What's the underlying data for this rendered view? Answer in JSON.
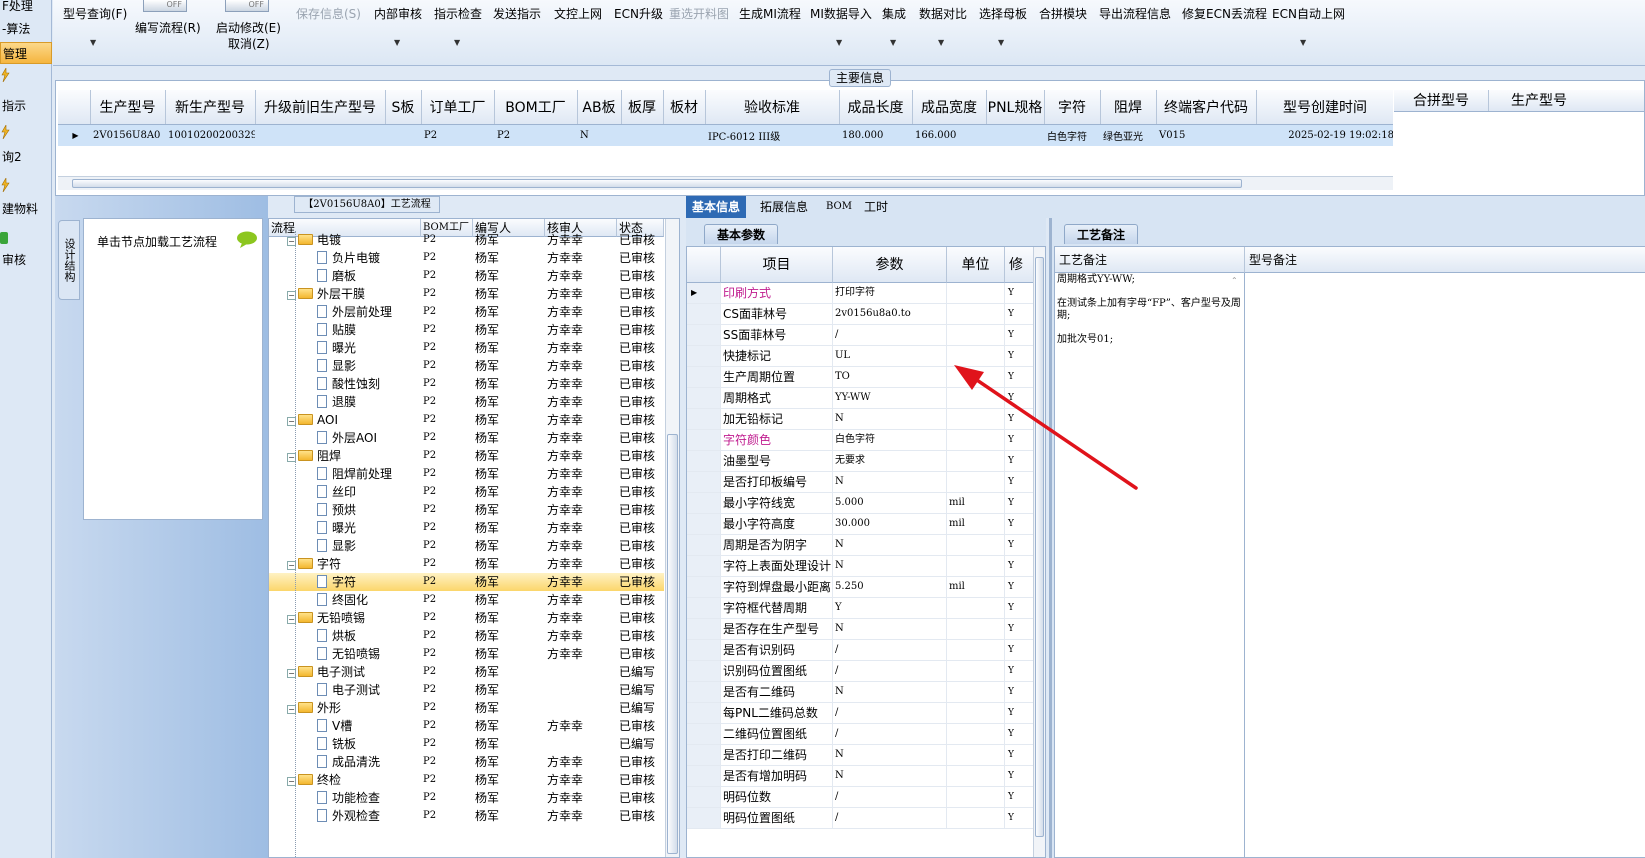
{
  "sidebar": {
    "items": [
      "F处理",
      "-算法",
      "管理",
      "指示",
      "询2",
      "建物料",
      "审核"
    ]
  },
  "ribbon": {
    "buttons": [
      "型号查询(F)",
      "编写流程(R)",
      "启动修改(E)",
      "取消(Z)",
      "保存信息(S)",
      "内部审核",
      "指示检查",
      "发送指示",
      "文控上网",
      "ECN升级",
      "重选开料图",
      "生成MI流程",
      "MI数据导入",
      "集成",
      "数据对比",
      "选择母板",
      "合拼模块",
      "导出流程信息",
      "修复ECN丢流程",
      "ECN自动上网"
    ],
    "toggle_label": "OFF"
  },
  "main_info": {
    "caption": "主要信息",
    "columns": [
      "生产型号",
      "新生产型号",
      "升级前旧生产型号",
      "S板",
      "订单工厂",
      "BOM工厂",
      "AB板",
      "板厚",
      "板材",
      "验收标准",
      "成品长度",
      "成品宽度",
      "PNL规格",
      "字符",
      "阻焊",
      "终端客户代码",
      "型号创建时间"
    ],
    "row": [
      "2V0156U8A0",
      "10010200200329",
      "",
      "",
      "P2",
      "P2",
      "N",
      "",
      "",
      "IPC-6012 III级",
      "180.000",
      "166.000",
      "",
      "白色字符",
      "绿色亚光",
      "V015",
      "2025-02-19 19:02:18"
    ],
    "right_columns": [
      "合拼型号",
      "生产型号"
    ]
  },
  "left_panel": {
    "vertical_tab": "设计结构",
    "hint": "单击节点加载工艺流程"
  },
  "process_tree": {
    "title": "【2V0156U8A0】工艺流程",
    "columns": [
      "流程",
      "BOM工厂",
      "编写人",
      "核审人",
      "状态"
    ],
    "rows": [
      {
        "name": "电镀",
        "level": 0,
        "bom": "P2",
        "writer": "杨军",
        "reviewer": "方幸幸",
        "status": "已审核"
      },
      {
        "name": "负片电镀",
        "level": 1,
        "bom": "P2",
        "writer": "杨军",
        "reviewer": "方幸幸",
        "status": "已审核"
      },
      {
        "name": "磨板",
        "level": 1,
        "bom": "P2",
        "writer": "杨军",
        "reviewer": "方幸幸",
        "status": "已审核"
      },
      {
        "name": "外层干膜",
        "level": 0,
        "bom": "P2",
        "writer": "杨军",
        "reviewer": "方幸幸",
        "status": "已审核"
      },
      {
        "name": "外层前处理",
        "level": 1,
        "bom": "P2",
        "writer": "杨军",
        "reviewer": "方幸幸",
        "status": "已审核"
      },
      {
        "name": "贴膜",
        "level": 1,
        "bom": "P2",
        "writer": "杨军",
        "reviewer": "方幸幸",
        "status": "已审核"
      },
      {
        "name": "曝光",
        "level": 1,
        "bom": "P2",
        "writer": "杨军",
        "reviewer": "方幸幸",
        "status": "已审核"
      },
      {
        "name": "显影",
        "level": 1,
        "bom": "P2",
        "writer": "杨军",
        "reviewer": "方幸幸",
        "status": "已审核"
      },
      {
        "name": "酸性蚀刻",
        "level": 1,
        "bom": "P2",
        "writer": "杨军",
        "reviewer": "方幸幸",
        "status": "已审核"
      },
      {
        "name": "退膜",
        "level": 1,
        "bom": "P2",
        "writer": "杨军",
        "reviewer": "方幸幸",
        "status": "已审核"
      },
      {
        "name": "AOI",
        "level": 0,
        "bom": "P2",
        "writer": "杨军",
        "reviewer": "方幸幸",
        "status": "已审核"
      },
      {
        "name": "外层AOI",
        "level": 1,
        "bom": "P2",
        "writer": "杨军",
        "reviewer": "方幸幸",
        "status": "已审核"
      },
      {
        "name": "阻焊",
        "level": 0,
        "bom": "P2",
        "writer": "杨军",
        "reviewer": "方幸幸",
        "status": "已审核"
      },
      {
        "name": "阻焊前处理",
        "level": 1,
        "bom": "P2",
        "writer": "杨军",
        "reviewer": "方幸幸",
        "status": "已审核"
      },
      {
        "name": "丝印",
        "level": 1,
        "bom": "P2",
        "writer": "杨军",
        "reviewer": "方幸幸",
        "status": "已审核"
      },
      {
        "name": "预烘",
        "level": 1,
        "bom": "P2",
        "writer": "杨军",
        "reviewer": "方幸幸",
        "status": "已审核"
      },
      {
        "name": "曝光",
        "level": 1,
        "bom": "P2",
        "writer": "杨军",
        "reviewer": "方幸幸",
        "status": "已审核"
      },
      {
        "name": "显影",
        "level": 1,
        "bom": "P2",
        "writer": "杨军",
        "reviewer": "方幸幸",
        "status": "已审核"
      },
      {
        "name": "字符",
        "level": 0,
        "bom": "P2",
        "writer": "杨军",
        "reviewer": "方幸幸",
        "status": "已审核"
      },
      {
        "name": "字符",
        "level": 1,
        "bom": "P2",
        "writer": "杨军",
        "reviewer": "方幸幸",
        "status": "已审核",
        "selected": true
      },
      {
        "name": "终固化",
        "level": 1,
        "bom": "P2",
        "writer": "杨军",
        "reviewer": "方幸幸",
        "status": "已审核"
      },
      {
        "name": "无铅喷锡",
        "level": 0,
        "bom": "P2",
        "writer": "杨军",
        "reviewer": "方幸幸",
        "status": "已审核"
      },
      {
        "name": "烘板",
        "level": 1,
        "bom": "P2",
        "writer": "杨军",
        "reviewer": "方幸幸",
        "status": "已审核"
      },
      {
        "name": "无铅喷锡",
        "level": 1,
        "bom": "P2",
        "writer": "杨军",
        "reviewer": "方幸幸",
        "status": "已审核"
      },
      {
        "name": "电子测试",
        "level": 0,
        "bom": "P2",
        "writer": "杨军",
        "reviewer": "",
        "status": "已编写"
      },
      {
        "name": "电子测试",
        "level": 1,
        "bom": "P2",
        "writer": "杨军",
        "reviewer": "",
        "status": "已编写"
      },
      {
        "name": "外形",
        "level": 0,
        "bom": "P2",
        "writer": "杨军",
        "reviewer": "",
        "status": "已编写"
      },
      {
        "name": "V槽",
        "level": 1,
        "bom": "P2",
        "writer": "杨军",
        "reviewer": "方幸幸",
        "status": "已审核"
      },
      {
        "name": "铣板",
        "level": 1,
        "bom": "P2",
        "writer": "杨军",
        "reviewer": "",
        "status": "已编写"
      },
      {
        "name": "成品清洗",
        "level": 1,
        "bom": "P2",
        "writer": "杨军",
        "reviewer": "方幸幸",
        "status": "已审核"
      },
      {
        "name": "终检",
        "level": 0,
        "bom": "P2",
        "writer": "杨军",
        "reviewer": "方幸幸",
        "status": "已审核"
      },
      {
        "name": "功能检查",
        "level": 1,
        "bom": "P2",
        "writer": "杨军",
        "reviewer": "方幸幸",
        "status": "已审核"
      },
      {
        "name": "外观检查",
        "level": 1,
        "bom": "P2",
        "writer": "杨军",
        "reviewer": "方幸幸",
        "status": "已审核"
      }
    ]
  },
  "detail_tabs": [
    "基本信息",
    "拓展信息",
    "BOM",
    "工时"
  ],
  "basic_params": {
    "section_tab": "基本参数",
    "columns": [
      "项目",
      "参数",
      "单位",
      "修"
    ],
    "rows": [
      {
        "item": "印刷方式",
        "value": "打印字符",
        "unit": "",
        "flag": "Y",
        "pink": true
      },
      {
        "item": "CS面菲林号",
        "value": "2v0156u8a0.to",
        "unit": "",
        "flag": "Y"
      },
      {
        "item": "SS面菲林号",
        "value": "/",
        "unit": "",
        "flag": "Y"
      },
      {
        "item": "快捷标记",
        "value": "UL",
        "unit": "",
        "flag": "Y"
      },
      {
        "item": "生产周期位置",
        "value": "TO",
        "unit": "",
        "flag": "Y"
      },
      {
        "item": "周期格式",
        "value": "YY-WW",
        "unit": "",
        "flag": "Y"
      },
      {
        "item": "加无铅标记",
        "value": "N",
        "unit": "",
        "flag": "Y"
      },
      {
        "item": "字符颜色",
        "value": "白色字符",
        "unit": "",
        "flag": "Y",
        "pink": true
      },
      {
        "item": "油墨型号",
        "value": "无要求",
        "unit": "",
        "flag": "Y"
      },
      {
        "item": "是否打印板编号",
        "value": "N",
        "unit": "",
        "flag": "Y"
      },
      {
        "item": "最小字符线宽",
        "value": "5.000",
        "unit": "mil",
        "flag": "Y"
      },
      {
        "item": "最小字符高度",
        "value": "30.000",
        "unit": "mil",
        "flag": "Y"
      },
      {
        "item": "周期是否为阴字",
        "value": "N",
        "unit": "",
        "flag": "Y"
      },
      {
        "item": "字符上表面处理设计",
        "value": "N",
        "unit": "",
        "flag": "Y"
      },
      {
        "item": "字符到焊盘最小距离",
        "value": "5.250",
        "unit": "mil",
        "flag": "Y"
      },
      {
        "item": "字符框代替周期",
        "value": "Y",
        "unit": "",
        "flag": "Y"
      },
      {
        "item": "是否存在生产型号",
        "value": "N",
        "unit": "",
        "flag": "Y"
      },
      {
        "item": "是否有识别码",
        "value": "/",
        "unit": "",
        "flag": "Y"
      },
      {
        "item": "识别码位置图纸",
        "value": "/",
        "unit": "",
        "flag": "Y"
      },
      {
        "item": "是否有二维码",
        "value": "N",
        "unit": "",
        "flag": "Y"
      },
      {
        "item": "每PNL二维码总数",
        "value": "/",
        "unit": "",
        "flag": "Y"
      },
      {
        "item": "二维码位置图纸",
        "value": "/",
        "unit": "",
        "flag": "Y"
      },
      {
        "item": "是否打印二维码",
        "value": "N",
        "unit": "",
        "flag": "Y"
      },
      {
        "item": "是否有增加明码",
        "value": "N",
        "unit": "",
        "flag": "Y"
      },
      {
        "item": "明码位数",
        "value": "/",
        "unit": "",
        "flag": "Y"
      },
      {
        "item": "明码位置图纸",
        "value": "/",
        "unit": "",
        "flag": "Y"
      }
    ]
  },
  "remarks": {
    "section_tab": "工艺备注",
    "columns": [
      "工艺备注",
      "型号备注"
    ],
    "lines": [
      "周期格式YY-WW;",
      "在测试条上加有字母“FP”、客户型号及周期;",
      "加批次号01;"
    ]
  },
  "colors": {
    "accent": "#2e6ab4",
    "selected_row": "#cfe3f8",
    "arrow": "#e0131b",
    "pink_text": "#c01c8f"
  }
}
